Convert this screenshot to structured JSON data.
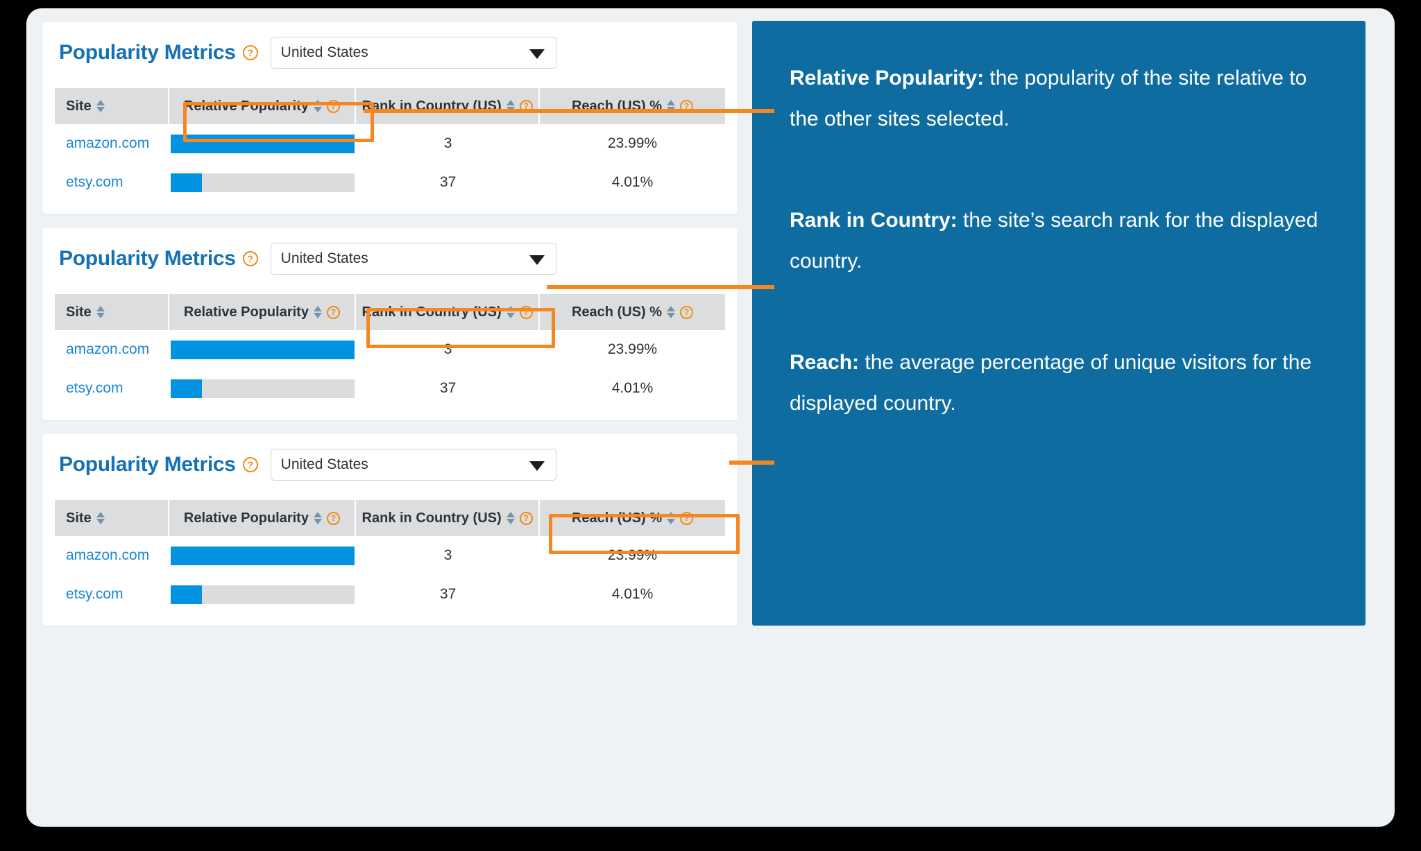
{
  "app": {
    "accent_orange": "#f5871f",
    "brand_blue": "#1471b5",
    "bar_blue": "#0193e2",
    "annotation_bg": "#0e6ca0"
  },
  "panels": [
    {
      "title": "Popularity Metrics",
      "help_icon": "help-icon",
      "country": {
        "value": "United States",
        "caret_icon": "chevron-down-icon"
      },
      "highlight_column": "relative_popularity",
      "columns": [
        {
          "key": "site",
          "label": "Site",
          "sort_icon": "sort-arrows-icon",
          "help": false
        },
        {
          "key": "relative_popularity",
          "label": "Relative Popularity",
          "sort_icon": "sort-arrows-icon",
          "help": true
        },
        {
          "key": "rank",
          "label": "Rank in Country (US)",
          "sort_icon": "sort-arrows-icon",
          "help": true
        },
        {
          "key": "reach",
          "label": "Reach (US) %",
          "sort_icon": "sort-arrows-icon",
          "help": true
        }
      ],
      "rows": [
        {
          "site": "amazon.com",
          "relative_popularity": 100,
          "rank": "3",
          "reach": "23.99%"
        },
        {
          "site": "etsy.com",
          "relative_popularity": 17,
          "rank": "37",
          "reach": "4.01%"
        }
      ]
    },
    {
      "title": "Popularity Metrics",
      "help_icon": "help-icon",
      "country": {
        "value": "United States",
        "caret_icon": "chevron-down-icon"
      },
      "highlight_column": "rank",
      "columns": [
        {
          "key": "site",
          "label": "Site",
          "sort_icon": "sort-arrows-icon",
          "help": false
        },
        {
          "key": "relative_popularity",
          "label": "Relative Popularity",
          "sort_icon": "sort-arrows-icon",
          "help": true
        },
        {
          "key": "rank",
          "label": "Rank in Country (US)",
          "sort_icon": "sort-arrows-icon",
          "help": true
        },
        {
          "key": "reach",
          "label": "Reach (US) %",
          "sort_icon": "sort-arrows-icon",
          "help": true
        }
      ],
      "rows": [
        {
          "site": "amazon.com",
          "relative_popularity": 100,
          "rank": "3",
          "reach": "23.99%"
        },
        {
          "site": "etsy.com",
          "relative_popularity": 17,
          "rank": "37",
          "reach": "4.01%"
        }
      ]
    },
    {
      "title": "Popularity Metrics",
      "help_icon": "help-icon",
      "country": {
        "value": "United States",
        "caret_icon": "chevron-down-icon"
      },
      "highlight_column": "reach",
      "columns": [
        {
          "key": "site",
          "label": "Site",
          "sort_icon": "sort-arrows-icon",
          "help": false
        },
        {
          "key": "relative_popularity",
          "label": "Relative Popularity",
          "sort_icon": "sort-arrows-icon",
          "help": true
        },
        {
          "key": "rank",
          "label": "Rank in Country (US)",
          "sort_icon": "sort-arrows-icon",
          "help": true
        },
        {
          "key": "reach",
          "label": "Reach (US) %",
          "sort_icon": "sort-arrows-icon",
          "help": true
        }
      ],
      "rows": [
        {
          "site": "amazon.com",
          "relative_popularity": 100,
          "rank": "3",
          "reach": "23.99%"
        },
        {
          "site": "etsy.com",
          "relative_popularity": 17,
          "rank": "37",
          "reach": "4.01%"
        }
      ]
    }
  ],
  "annotations": [
    {
      "term": "Relative Popularity:",
      "text": " the popularity of the site relative to the other sites selected."
    },
    {
      "term": "Rank in Country:",
      "text": " the site’s search rank for the displayed country."
    },
    {
      "term": "Reach:",
      "text": " the average percentage of unique visitors for the displayed country."
    }
  ]
}
